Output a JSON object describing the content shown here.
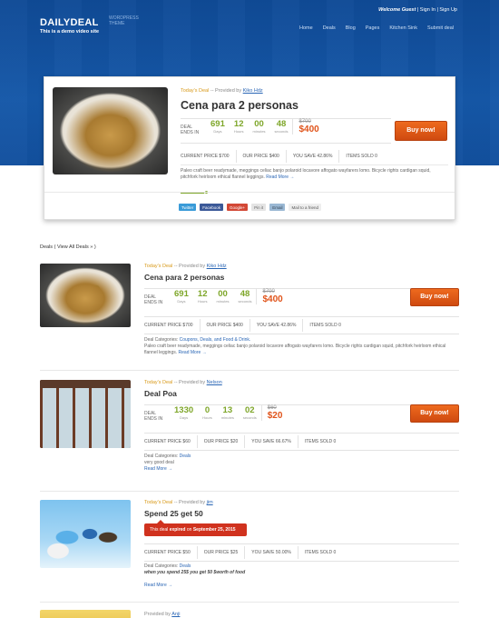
{
  "header": {
    "logo": "DAILYDEAL",
    "logo_sub": "WORDPRESS THEME",
    "tagline": "This is a demo video site",
    "welcome": "Welcome Guest",
    "sign_in": "Sign In",
    "sign_up": "Sign Up",
    "nav": [
      "Home",
      "Deals",
      "Blog",
      "Pages",
      "Kitchen Sink",
      "Submit deal"
    ]
  },
  "featured": {
    "today_label": "Today's Deal",
    "provided_by": "-- Provided by",
    "provider": "Kiko Hdz",
    "title": "Cena para 2 personas",
    "deal_ends_in": "DEAL ENDS IN",
    "countdown": [
      {
        "num": "691",
        "cap": "Days"
      },
      {
        "num": "12",
        "cap": "Hours"
      },
      {
        "num": "00",
        "cap": "minutes"
      },
      {
        "num": "48",
        "cap": "seconds"
      }
    ],
    "old_price": "$700",
    "new_price": "$400",
    "buy_label": "Buy now!",
    "current_price": "CURRENT PRICE $700",
    "our_price": "OUR PRICE $400",
    "you_save": "YOU SAVE 42.86%",
    "items_sold": "ITEMS SOLD 0",
    "description": "Paleo craft beer readymade, meggings celiac banjo polaroid locavore affogato wayfarers lomo. Bicycle rights cardigan squid, pitchfork heirloom ethical flannel leggings.",
    "read_more": "Read More →",
    "share": [
      "Twitter",
      "Facebook",
      "Google+",
      "Pin it",
      "Email",
      "Mail to a friend"
    ]
  },
  "deals_heading": "Deals",
  "view_all": "( View All Deals » )",
  "deals": [
    {
      "today_label": "Today's Deal",
      "provided_by": "-- Provided by",
      "provider": "Kiko Hdz",
      "title": "Cena para 2 personas",
      "deal_ends_in": "DEAL ENDS IN",
      "countdown": [
        {
          "num": "691",
          "cap": "Days"
        },
        {
          "num": "12",
          "cap": "Hours"
        },
        {
          "num": "00",
          "cap": "minutes"
        },
        {
          "num": "48",
          "cap": "seconds"
        }
      ],
      "old_price": "$700",
      "new_price": "$400",
      "buy_label": "Buy now!",
      "current_price": "CURRENT PRICE $700",
      "our_price": "OUR PRICE $400",
      "you_save": "YOU SAVE 42.86%",
      "items_sold": "ITEMS SOLD 0",
      "categories_label": "Deal Categories:",
      "categories": "Coupons, Deals, and Food & Drink.",
      "description": "Paleo craft beer readymade, meggings celiac banjo polaroid locavore affogato wayfarers lomo. Bicycle rights cardigan squid, pitchfork heirloom ethical flannel leggings.",
      "read_more": "Read More →"
    },
    {
      "today_label": "Today's Deal",
      "provided_by": "-- Provided by",
      "provider": "Nelson",
      "title": "Deal Poa",
      "deal_ends_in": "DEAL ENDS IN",
      "countdown": [
        {
          "num": "1330",
          "cap": "Days"
        },
        {
          "num": "0",
          "cap": "Hours"
        },
        {
          "num": "13",
          "cap": "minutes"
        },
        {
          "num": "02",
          "cap": "seconds"
        }
      ],
      "old_price": "$60",
      "new_price": "$20",
      "buy_label": "Buy now!",
      "current_price": "CURRENT PRICE $60",
      "our_price": "OUR PRICE $20",
      "you_save": "YOU SAVE 66.67%",
      "items_sold": "ITEMS SOLD 0",
      "categories_label": "Deal Categories:",
      "categories": "Deals",
      "description": "very good deal",
      "read_more": "Read More →"
    },
    {
      "today_label": "Today's Deal",
      "provided_by": "-- Provided by",
      "provider": "jim",
      "title": "Spend 25 get 50",
      "expired_prefix": "This deal",
      "expired_word": "expired",
      "expired_on": "on",
      "expired_date": "September 25, 2015",
      "current_price": "CURRENT PRICE $50",
      "our_price": "OUR PRICE $25",
      "you_save": "YOU SAVE 50.00%",
      "items_sold": "ITEMS SOLD 0",
      "categories_label": "Deal Categories:",
      "categories": "Deals",
      "description": "when you spend 25$ you get 50 $worth of food",
      "read_more": "Read More →"
    },
    {
      "provided_by": "Provided by",
      "provider": "Anji"
    }
  ],
  "colors": {
    "header_blue": "#12509e",
    "accent_green": "#7ea629",
    "price_orange": "#e0541b",
    "buy_orange": "#e35f18",
    "expired_red": "#d0321e",
    "link_blue": "#2a66b5"
  }
}
